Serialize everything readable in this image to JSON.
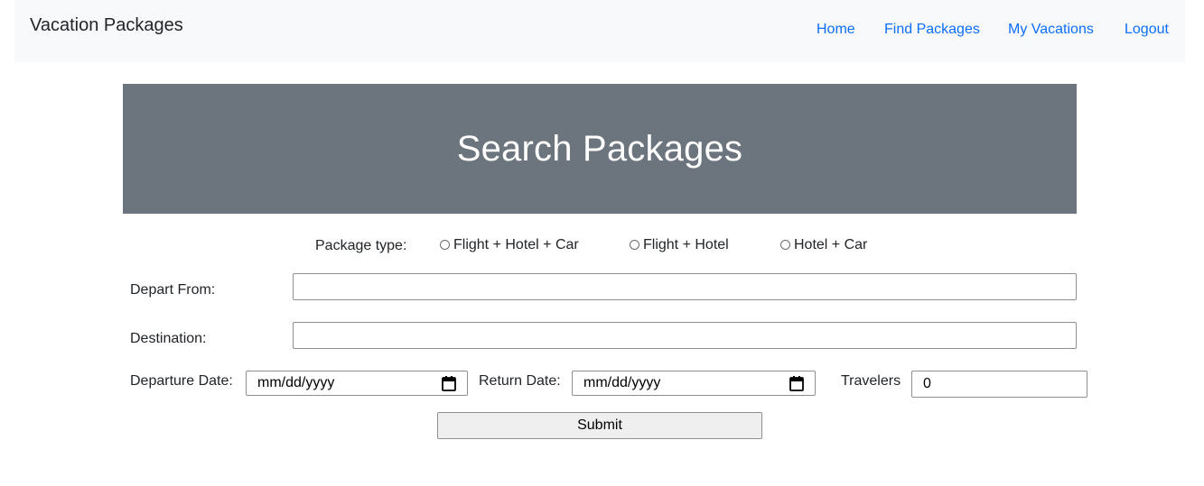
{
  "navbar": {
    "brand": "Vacation Packages",
    "links": [
      "Home",
      "Find Packages",
      "My Vacations",
      "Logout"
    ]
  },
  "hero": {
    "title": "Search Packages"
  },
  "form": {
    "package_type_label": "Package type:",
    "package_options": [
      "Flight + Hotel + Car",
      "Flight + Hotel",
      "Hotel + Car"
    ],
    "depart_from_label": "Depart From:",
    "depart_from_value": "",
    "destination_label": "Destination:",
    "destination_value": "",
    "departure_date_label": "Departure Date:",
    "departure_date_placeholder": "mm/dd/yyyy",
    "return_date_label": "Return Date:",
    "return_date_placeholder": "mm/dd/yyyy",
    "travelers_label": "Travelers",
    "travelers_value": "0",
    "submit_label": "Submit"
  },
  "icons": {
    "date_picker": "calendar-icon",
    "radio": "radio-unchecked"
  },
  "colors": {
    "link": "#0d6efd",
    "hero_bg": "#6c757d",
    "navbar_bg": "#f8f9fa"
  }
}
